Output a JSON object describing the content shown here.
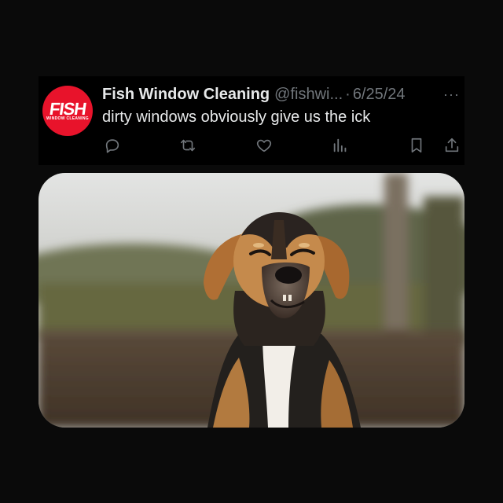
{
  "tweet": {
    "avatar_text": "FISH",
    "avatar_sub": "WINDOW CLEANING",
    "display_name": "Fish Window Cleaning",
    "handle": "@fishwi...",
    "separator": "·",
    "date": "6/25/24",
    "more_label": "···",
    "text": "dirty windows obviously give us the ick"
  },
  "actions": [
    "reply-icon",
    "retweet-icon",
    "like-icon",
    "views-icon",
    "bookmark-icon",
    "share-icon"
  ],
  "colors": {
    "background": "#0a0a0a",
    "card": "#000000",
    "text": "#e7e9ea",
    "muted": "#71767b",
    "brand": "#e8132b"
  }
}
